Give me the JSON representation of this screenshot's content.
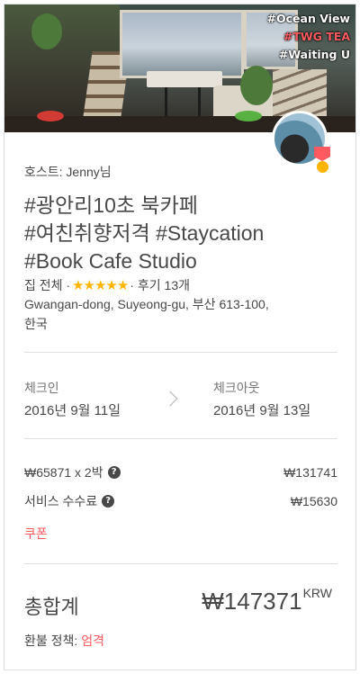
{
  "hero": {
    "tags": [
      "#Ocean View",
      "#TWG TEA",
      "#Waiting U"
    ]
  },
  "host": {
    "label": "호스트: Jenny님"
  },
  "listing": {
    "title_lines": [
      "#광안리10초 북카페",
      "#여친취향저격 #Staycation",
      "#Book Cafe Studio"
    ],
    "type": "집 전체",
    "rating_stars": 5,
    "stars": "★★★★★",
    "reviews": "후기 13개",
    "address_line1": "Gwangan-dong, Suyeong-gu, 부산 613-100,",
    "address_line2": "한국"
  },
  "dates": {
    "checkin_label": "체크인",
    "checkin_value": "2016년 9월 11일",
    "checkout_label": "체크아웃",
    "checkout_value": "2016년 9월 13일"
  },
  "pricing": {
    "nightly_label": "₩65871 x 2박",
    "nightly_total": "₩131741",
    "service_label": "서비스 수수료",
    "service_total": "₩15630",
    "coupon_label": "쿠폰",
    "total_label": "총합계",
    "total_value": "₩147371",
    "currency": "KRW",
    "refund_label": "환불 정책:",
    "refund_policy": "엄격"
  },
  "colors": {
    "accent": "#ff5a5f",
    "star": "#ffb400",
    "text": "#484848"
  }
}
